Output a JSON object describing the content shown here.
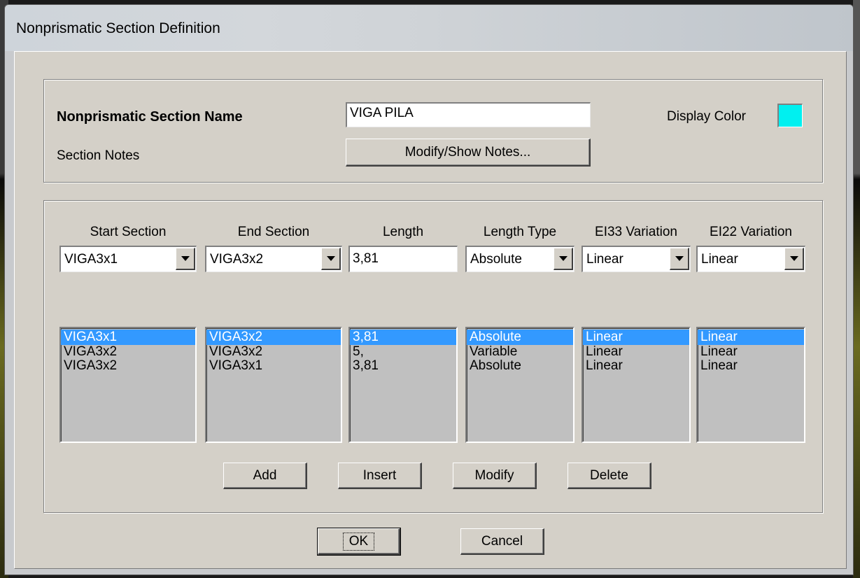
{
  "window": {
    "title": "Nonprismatic Section Definition"
  },
  "header": {
    "name_label": "Nonprismatic Section Name",
    "name_value": "VIGA PILA",
    "color_label": "Display Color",
    "color_value": "#00f0f0",
    "notes_label": "Section Notes",
    "notes_button": "Modify/Show Notes..."
  },
  "columns": [
    {
      "header": "Start Section",
      "current": "VIGA3x1",
      "items": [
        "VIGA3x1",
        "VIGA3x2",
        "VIGA3x2"
      ]
    },
    {
      "header": "End Section",
      "current": "VIGA3x2",
      "items": [
        "VIGA3x2",
        "VIGA3x2",
        "VIGA3x1"
      ]
    },
    {
      "header": "Length",
      "current": "3,81",
      "items": [
        "3,81",
        "5,",
        "3,81"
      ]
    },
    {
      "header": "Length Type",
      "current": "Absolute",
      "items": [
        "Absolute",
        "Variable",
        "Absolute"
      ]
    },
    {
      "header": "EI33 Variation",
      "current": "Linear",
      "items": [
        "Linear",
        "Linear",
        "Linear"
      ]
    },
    {
      "header": "EI22 Variation",
      "current": "Linear",
      "items": [
        "Linear",
        "Linear",
        "Linear"
      ]
    }
  ],
  "actions": {
    "add": "Add",
    "insert": "Insert",
    "modify": "Modify",
    "delete": "Delete"
  },
  "footer": {
    "ok": "OK",
    "cancel": "Cancel"
  },
  "colors": {
    "selection": "#3399ff",
    "dialog_bg": "#d4d0c8"
  }
}
